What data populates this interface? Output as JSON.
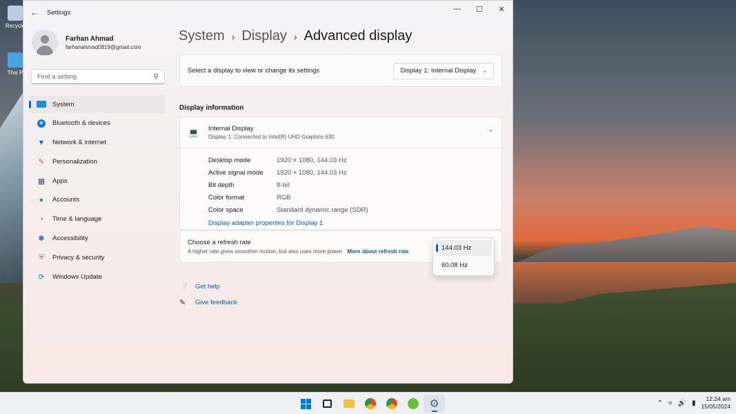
{
  "desktop": {
    "icons": [
      {
        "label": "Recycle"
      },
      {
        "label": "This P"
      }
    ]
  },
  "window": {
    "title": "Settings",
    "controls": {
      "minimize": "—",
      "maximize": "☐",
      "close": "✕"
    }
  },
  "profile": {
    "name": "Farhan Ahmad",
    "email": "farhanahmad0819@gmail.com"
  },
  "search": {
    "placeholder": "Find a setting"
  },
  "sidebar": {
    "items": [
      {
        "label": "System",
        "icon": "monitor-icon",
        "active": true
      },
      {
        "label": "Bluetooth & devices",
        "icon": "bluetooth-icon"
      },
      {
        "label": "Network & internet",
        "icon": "wifi-icon"
      },
      {
        "label": "Personalization",
        "icon": "brush-icon"
      },
      {
        "label": "Apps",
        "icon": "apps-icon"
      },
      {
        "label": "Accounts",
        "icon": "person-icon"
      },
      {
        "label": "Time & language",
        "icon": "globe-icon"
      },
      {
        "label": "Accessibility",
        "icon": "accessibility-icon"
      },
      {
        "label": "Privacy & security",
        "icon": "shield-icon"
      },
      {
        "label": "Windows Update",
        "icon": "update-icon"
      }
    ]
  },
  "breadcrumb": {
    "items": [
      "System",
      "Display",
      "Advanced display"
    ]
  },
  "display_select": {
    "label": "Select a display to view or change its settings",
    "value": "Display 1: Internal Display"
  },
  "display_info": {
    "section_title": "Display information",
    "device_name": "Internal Display",
    "device_sub": "Display 1: Connected to Intel(R) UHD Graphics 630",
    "rows": [
      {
        "key": "Desktop mode",
        "value": "1920 × 1080, 144.03 Hz"
      },
      {
        "key": "Active signal mode",
        "value": "1920 × 1080, 144.03 Hz"
      },
      {
        "key": "Bit depth",
        "value": "8-bit"
      },
      {
        "key": "Color format",
        "value": "RGB"
      },
      {
        "key": "Color space",
        "value": "Standard dynamic range (SDR)"
      }
    ],
    "adapter_link": "Display adapter properties for Display 1"
  },
  "refresh_rate": {
    "title": "Choose a refresh rate",
    "subtitle": "A higher rate gives smoother motion, but also uses more power",
    "more_link": "More about refresh rate",
    "options": [
      "144.03 Hz",
      "60.08 Hz"
    ],
    "selected": "144.03 Hz"
  },
  "help": {
    "get_help": "Get help",
    "give_feedback": "Give feedback"
  },
  "taskbar": {
    "time": "12:24 am",
    "date": "15/05/2024",
    "colors": {
      "accent": "#0067c0",
      "start": "#0078d4"
    }
  }
}
